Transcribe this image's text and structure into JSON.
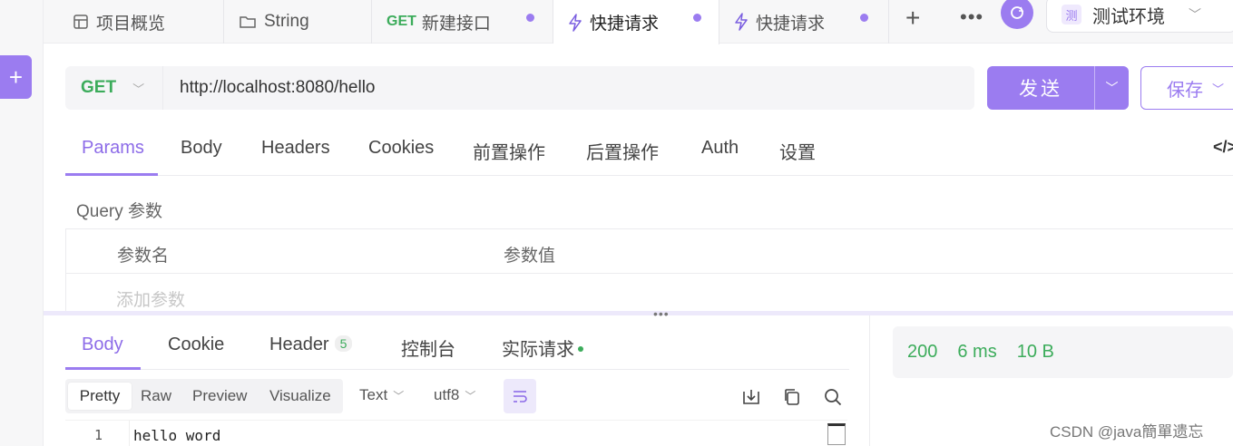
{
  "tabs": [
    {
      "label": "项目概览",
      "icon": "grid-icon"
    },
    {
      "label": "String",
      "icon": "folder-icon"
    },
    {
      "method": "GET",
      "label": "新建接口"
    },
    {
      "label": "快捷请求",
      "icon": "lightning-icon"
    },
    {
      "label": "快捷请求",
      "icon": "lightning-icon"
    }
  ],
  "environment": {
    "badge": "测",
    "label": "测试环境"
  },
  "request": {
    "method": "GET",
    "url": "http://localhost:8080/hello",
    "send_label": "发送",
    "save_label": "保存"
  },
  "request_tabs": [
    "Params",
    "Body",
    "Headers",
    "Cookies",
    "前置操作",
    "后置操作",
    "Auth",
    "设置"
  ],
  "code_icon": "</>",
  "query": {
    "label": "Query 参数",
    "col_name": "参数名",
    "col_value": "参数值",
    "add_placeholder": "添加参数"
  },
  "response_tabs": {
    "body": "Body",
    "cookie": "Cookie",
    "header": "Header",
    "header_count": "5",
    "console": "控制台",
    "actual": "实际请求"
  },
  "format_buttons": [
    "Pretty",
    "Raw",
    "Preview",
    "Visualize"
  ],
  "format_type": "Text",
  "encoding": "utf8",
  "response_body": {
    "line_number": "1",
    "text": "hello word"
  },
  "status": {
    "code": "200",
    "time": "6 ms",
    "size": "10 B"
  },
  "watermark": "CSDN @java簡單遗忘",
  "colors": {
    "accent": "#9b7cf0",
    "success": "#3cac5b"
  }
}
